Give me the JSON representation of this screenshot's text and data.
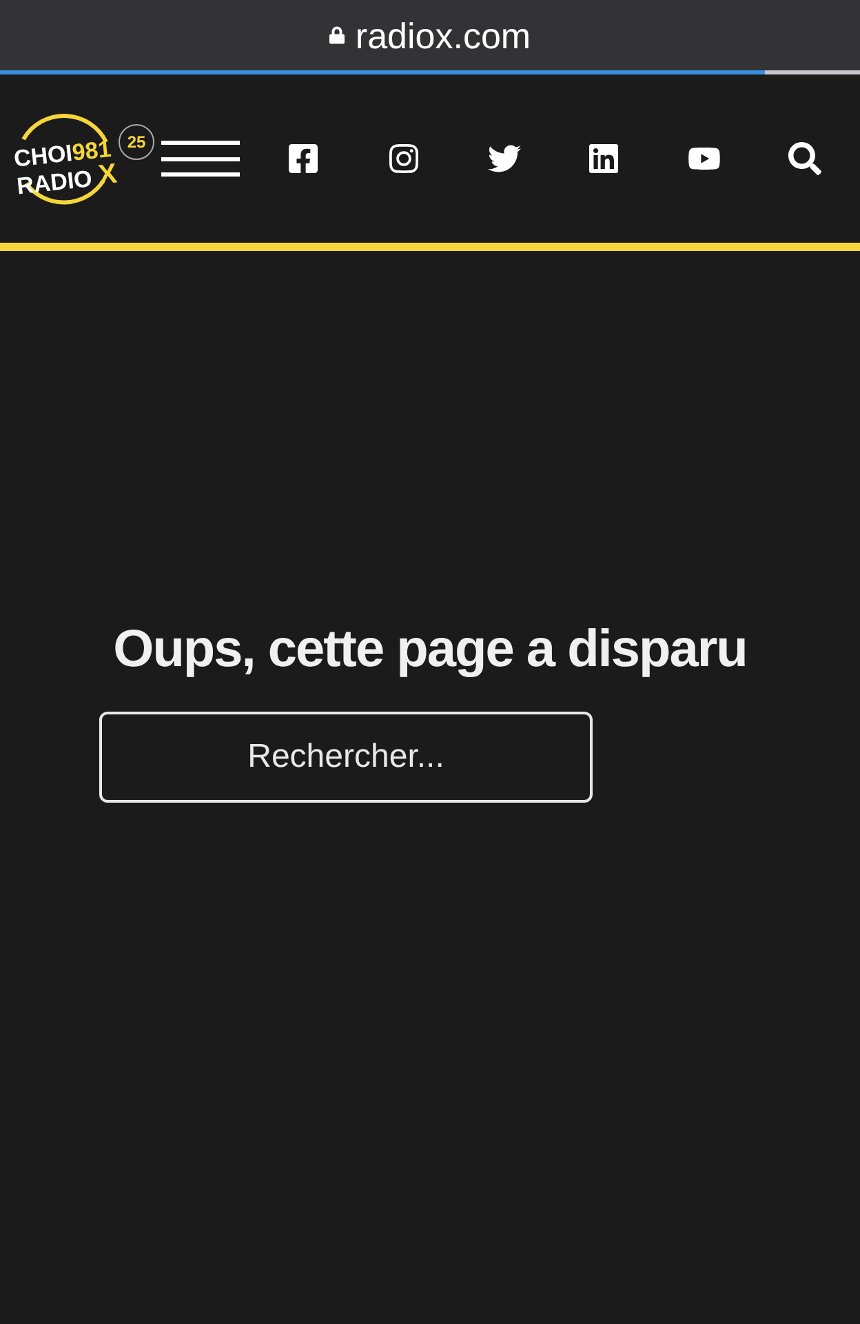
{
  "browser": {
    "url": "radiox.com",
    "load_progress": {
      "level": 0.89
    }
  },
  "logo": {
    "line_1": "CHOI",
    "frequency": "981",
    "line_2": "RADIO",
    "letter": "X",
    "anniversary": "25"
  },
  "error": {
    "heading": "Oups, cette page a disparu"
  },
  "search": {
    "placeholder": "Rechercher..."
  }
}
